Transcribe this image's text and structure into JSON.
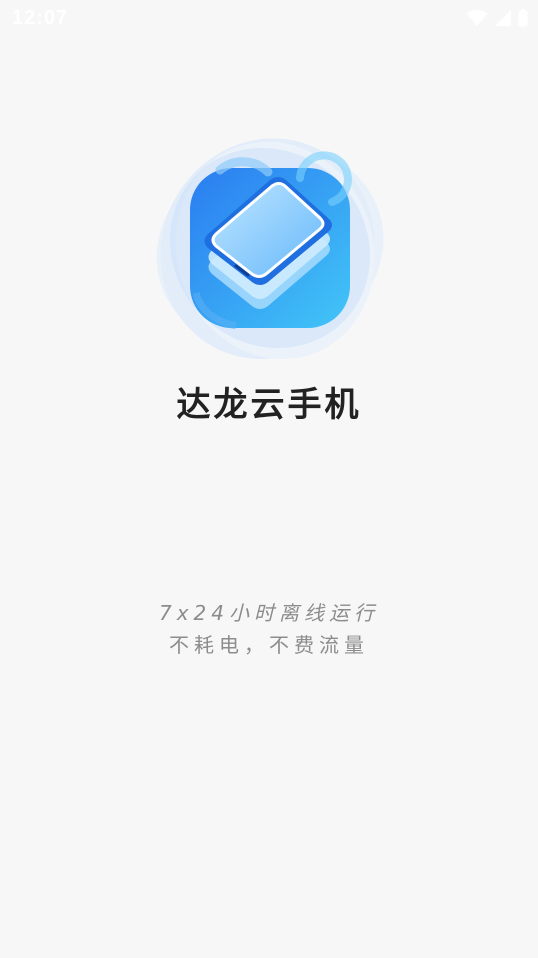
{
  "status_bar": {
    "time": "12:07",
    "icons": [
      "wifi-icon",
      "cell-signal-icon",
      "battery-icon"
    ]
  },
  "app": {
    "name": "达龙云手机",
    "logo_icon": "cloud-phone-logo-icon"
  },
  "slogan": {
    "line1": "7x24小时离线运行",
    "line2": "不耗电，不费流量"
  },
  "colors": {
    "background": "#f7f7f8",
    "brand_blue": "#2f8ff2",
    "title_text": "#222222",
    "slogan_text": "#8c8c8c"
  }
}
